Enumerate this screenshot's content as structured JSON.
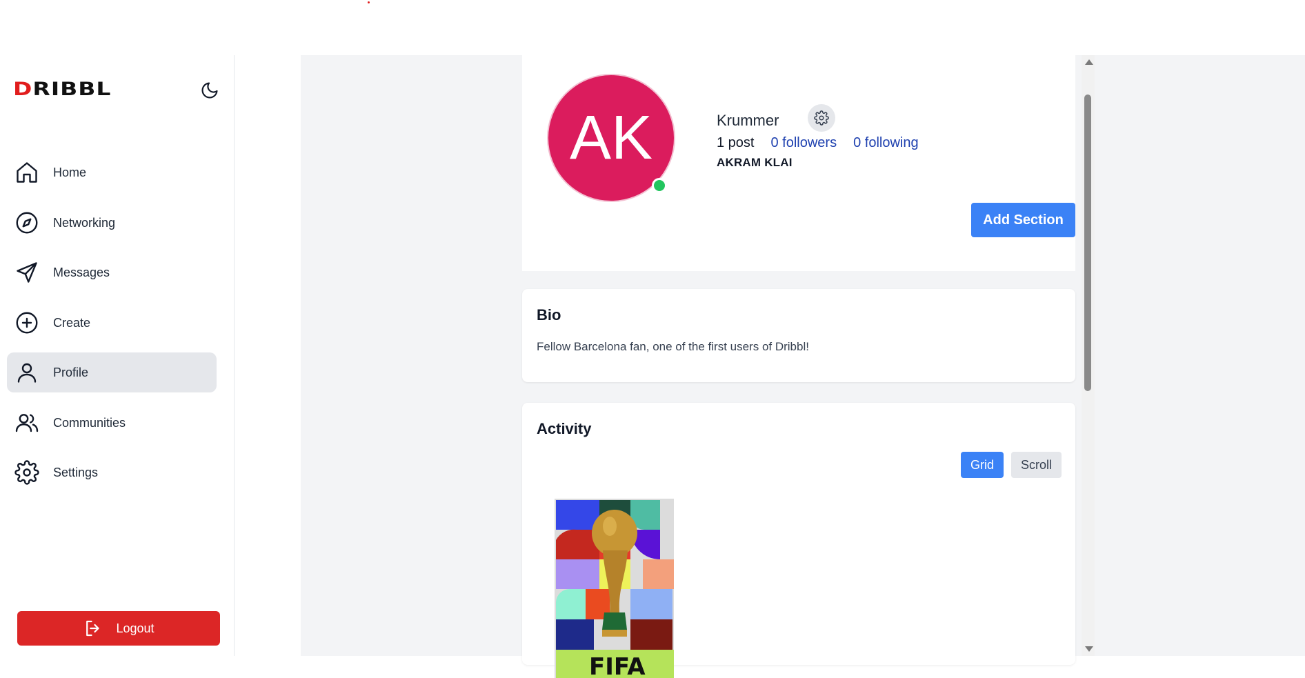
{
  "app": {
    "logo_first": "D",
    "logo_rest": "RIBBL"
  },
  "sidebar": {
    "items": [
      {
        "label": "Home",
        "icon": "home-icon"
      },
      {
        "label": "Networking",
        "icon": "compass-icon"
      },
      {
        "label": "Messages",
        "icon": "send-icon"
      },
      {
        "label": "Create",
        "icon": "plus-circle-icon"
      },
      {
        "label": "Profile",
        "icon": "user-icon",
        "active": true
      },
      {
        "label": "Communities",
        "icon": "users-icon"
      },
      {
        "label": "Settings",
        "icon": "gear-icon"
      }
    ],
    "logout_label": "Logout"
  },
  "profile": {
    "initials": "AK",
    "username": "Krummer",
    "posts": "1 post",
    "followers": "0 followers",
    "following": "0 following",
    "full_name": "AKRAM KLAI",
    "add_section_label": "Add Section",
    "online": true
  },
  "bio": {
    "title": "Bio",
    "text": "Fellow Barcelona fan, one of the first users of Dribbl!"
  },
  "activity": {
    "title": "Activity",
    "grid_label": "Grid",
    "scroll_label": "Scroll",
    "posts": [
      {
        "image_text": "FIFA"
      }
    ]
  },
  "colors": {
    "accent": "#3b82f6",
    "avatar": "#db1c5d",
    "logout": "#dc2626",
    "online": "#22c55e",
    "link": "#1e40af"
  }
}
